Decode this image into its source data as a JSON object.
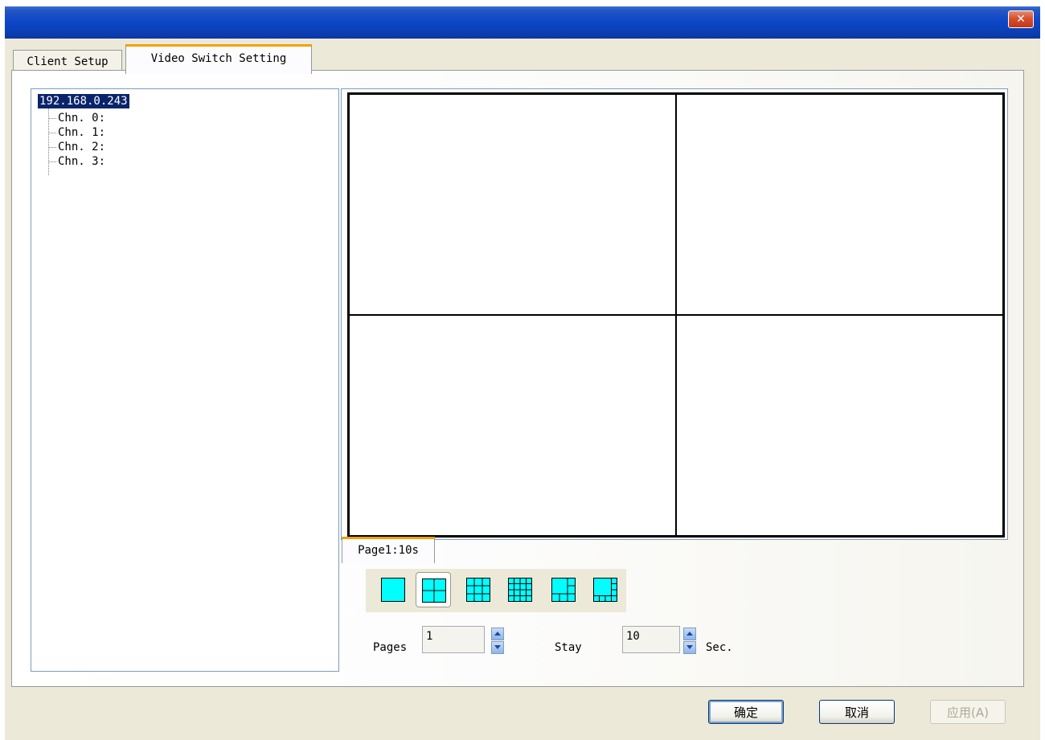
{
  "window": {
    "close_label": "✕"
  },
  "tabs": [
    {
      "label": "Client Setup",
      "active": false
    },
    {
      "label": "Video Switch Setting",
      "active": true
    }
  ],
  "tree": {
    "root": "192.168.0.243",
    "items": [
      "Chn. 0:",
      "Chn. 1:",
      "Chn. 2:",
      "Chn. 3:"
    ]
  },
  "page_tabs": [
    {
      "label": "Page1:10s"
    }
  ],
  "layouts": [
    {
      "icon": "layout-1-icon",
      "selected": false
    },
    {
      "icon": "layout-4-icon",
      "selected": true
    },
    {
      "icon": "layout-9-icon",
      "selected": false
    },
    {
      "icon": "layout-16-icon",
      "selected": false
    },
    {
      "icon": "layout-6-icon",
      "selected": false
    },
    {
      "icon": "layout-8-icon",
      "selected": false
    }
  ],
  "controls": {
    "pages_label": "Pages",
    "pages_value": "1",
    "stay_label": "Stay",
    "stay_value": "10",
    "sec_label": "Sec."
  },
  "buttons": {
    "ok": "确定",
    "cancel": "取消",
    "apply": "应用(A)"
  },
  "colors": {
    "layout_fill": "#00ffff",
    "selection": "#0a246a",
    "title_bar": "#0d47c8"
  }
}
